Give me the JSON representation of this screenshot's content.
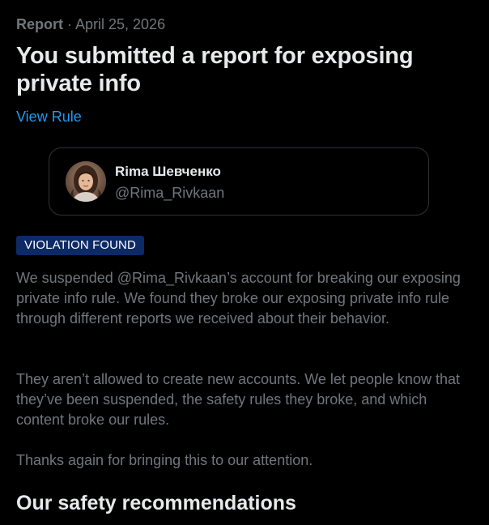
{
  "header": {
    "kind": "Report",
    "separator": "·",
    "date": "April 25, 2026",
    "title": "You submitted a report for exposing private info",
    "view_rule_label": "View Rule"
  },
  "reported_user": {
    "display_name": "Rima Шевченко",
    "handle": "@Rima_Rivkaan",
    "avatar_icon": "profile-photo"
  },
  "status": {
    "badge": "VIOLATION FOUND",
    "badge_color": "#0c2a66"
  },
  "body": {
    "paragraph_1": "We suspended @Rima_Rivkaan’s account for breaking our exposing private info rule. We found they broke our exposing private info rule through different reports we received about their behavior.",
    "paragraph_2": "They aren’t allowed to create new accounts. We let people know that they’ve been suspended, the safety rules they broke, and which content broke our rules.",
    "paragraph_3": "Thanks again for bringing this to our attention."
  },
  "recommendations": {
    "title": "Our safety recommendations"
  },
  "colors": {
    "background": "#000000",
    "primary_text": "#e7e9ea",
    "secondary_text": "#71767b",
    "link": "#1d9bf0",
    "card_border": "#2f3336"
  }
}
